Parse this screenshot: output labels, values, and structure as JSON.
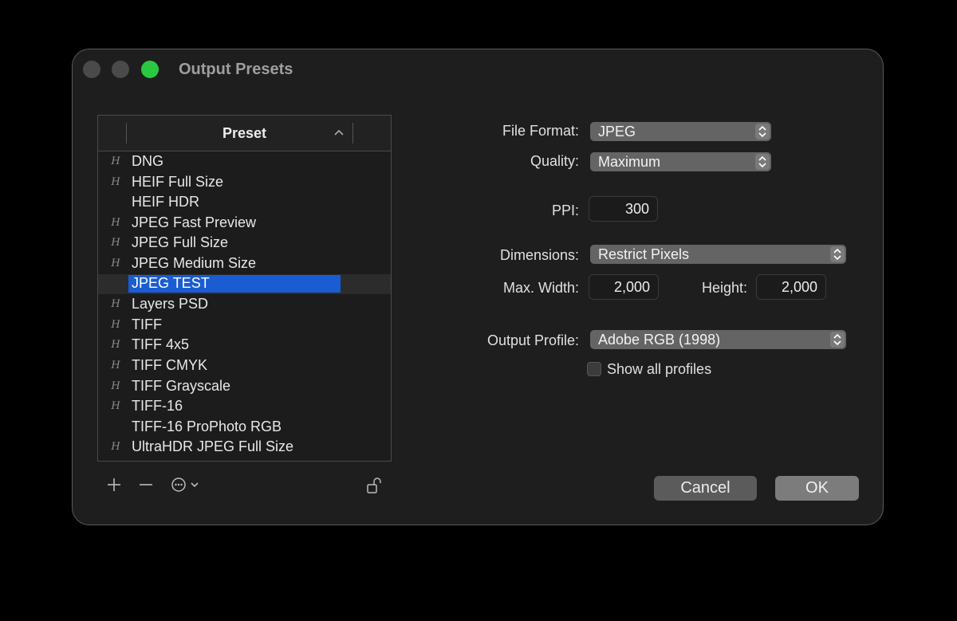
{
  "window": {
    "title": "Output Presets"
  },
  "preset_table": {
    "header": "Preset",
    "items": [
      {
        "label": "DNG",
        "icon": "preset-badge-icon",
        "has_icon": true
      },
      {
        "label": "HEIF Full Size",
        "icon": "preset-badge-icon",
        "has_icon": true
      },
      {
        "label": "HEIF HDR",
        "has_icon": false
      },
      {
        "label": "JPEG Fast Preview",
        "icon": "preset-badge-icon",
        "has_icon": true
      },
      {
        "label": "JPEG Full Size",
        "icon": "preset-badge-icon",
        "has_icon": true
      },
      {
        "label": "JPEG Medium Size",
        "icon": "preset-badge-icon",
        "has_icon": true
      },
      {
        "label": "JPEG TEST",
        "has_icon": false,
        "selected": true
      },
      {
        "label": "Layers PSD",
        "icon": "preset-badge-icon",
        "has_icon": true
      },
      {
        "label": "TIFF",
        "icon": "preset-badge-icon",
        "has_icon": true
      },
      {
        "label": "TIFF 4x5",
        "icon": "preset-badge-icon",
        "has_icon": true
      },
      {
        "label": "TIFF CMYK",
        "icon": "preset-badge-icon",
        "has_icon": true
      },
      {
        "label": "TIFF Grayscale",
        "icon": "preset-badge-icon",
        "has_icon": true
      },
      {
        "label": "TIFF-16",
        "icon": "preset-badge-icon",
        "has_icon": true
      },
      {
        "label": "TIFF-16 ProPhoto RGB",
        "has_icon": false
      },
      {
        "label": "UltraHDR JPEG Full Size",
        "icon": "preset-badge-icon",
        "has_icon": true
      }
    ],
    "badge_glyph": "H"
  },
  "toolbar": {
    "add_icon": "plus-icon",
    "remove_icon": "minus-icon",
    "more_icon": "ellipsis-circle-icon",
    "lock_icon": "unlock-icon"
  },
  "form": {
    "file_format_label": "File Format:",
    "file_format_value": "JPEG",
    "quality_label": "Quality:",
    "quality_value": "Maximum",
    "ppi_label": "PPI:",
    "ppi_value": "300",
    "dimensions_label": "Dimensions:",
    "dimensions_value": "Restrict Pixels",
    "max_width_label": "Max. Width:",
    "max_width_value": "2,000",
    "height_label": "Height:",
    "height_value": "2,000",
    "output_profile_label": "Output Profile:",
    "output_profile_value": "Adobe RGB (1998)",
    "show_all_profiles_label": "Show all profiles",
    "show_all_profiles_checked": false
  },
  "buttons": {
    "cancel": "Cancel",
    "ok": "OK"
  },
  "colors": {
    "selection": "#1a5cd2",
    "zoom_button": "#29c840",
    "window_bg": "#1e1e1e"
  }
}
